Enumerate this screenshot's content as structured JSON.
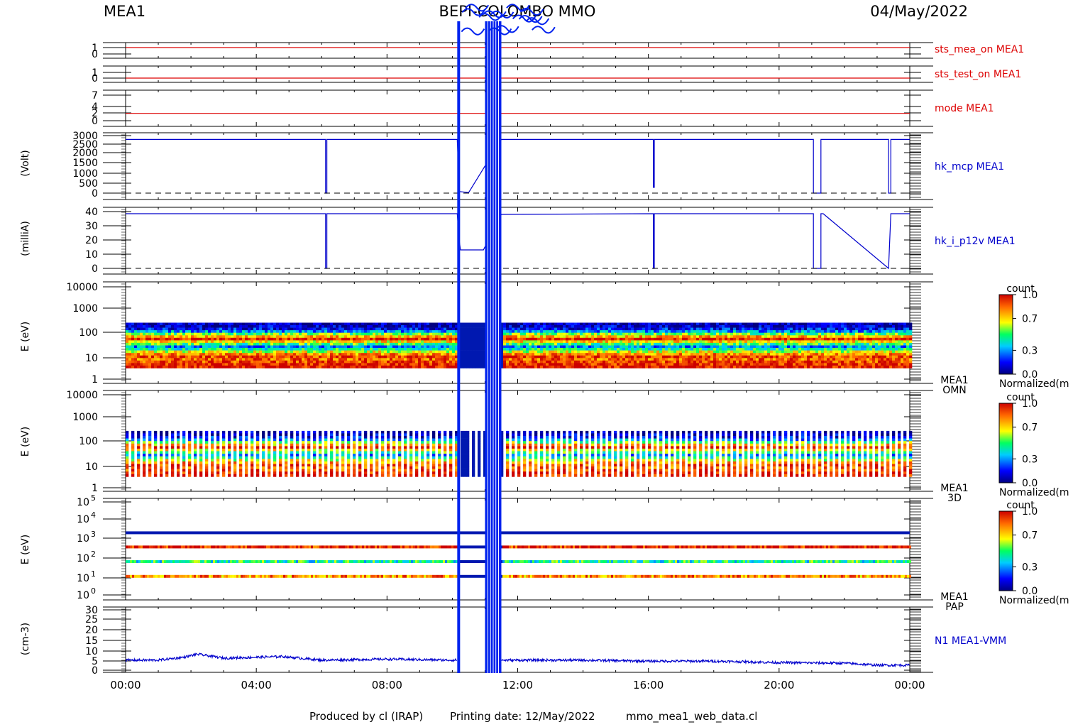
{
  "header": {
    "left": "MEA1",
    "center": "BEPI-COLOMBO MMO",
    "right": "04/May/2022"
  },
  "footer": {
    "producer": "Produced by cl (IRAP)",
    "printing": "Printing date: 12/May/2022",
    "script": "mmo_mea1_web_data.cl"
  },
  "colors": {
    "red_trace": "#dd0000",
    "blue_trace": "#0000cc",
    "gap_blue": "#0022ee"
  },
  "chart_data": {
    "type": "line",
    "x_ticks": [
      "00:00",
      "04:00",
      "08:00",
      "12:00",
      "16:00",
      "20:00",
      "00:00"
    ],
    "x_range_hours": [
      0,
      24
    ],
    "gaps": [
      {
        "start_hour": 10.15,
        "end_hour": 10.22
      },
      {
        "start_hour": 11.0,
        "end_hour": 11.5
      }
    ],
    "panels": [
      {
        "id": "sts_mea_on",
        "label": "sts_mea_on MEA1",
        "label_color": "#dd0000",
        "type": "line",
        "ylabel": "",
        "yticks": [
          "1",
          "0"
        ],
        "ylim": [
          0,
          1
        ],
        "series": [
          {
            "x": [
              0,
              24
            ],
            "y": [
              1,
              1
            ]
          }
        ]
      },
      {
        "id": "sts_test_on",
        "label": "sts_test_on MEA1",
        "label_color": "#dd0000",
        "type": "line",
        "ylabel": "",
        "yticks": [
          "1",
          "0"
        ],
        "ylim": [
          0,
          1
        ],
        "series": [
          {
            "x": [
              0,
              24
            ],
            "y": [
              0,
              0
            ]
          }
        ]
      },
      {
        "id": "mode",
        "label": "mode MEA1",
        "label_color": "#dd0000",
        "type": "line",
        "ylabel": "",
        "yticks": [
          "7",
          "4",
          "2",
          "0"
        ],
        "ylim": [
          0,
          7
        ],
        "series": [
          {
            "x": [
              0,
              24
            ],
            "y": [
              2,
              2
            ]
          }
        ]
      },
      {
        "id": "hk_mcp",
        "label": "hk_mcp MEA1",
        "label_color": "#0000cc",
        "type": "line",
        "ylabel": "(Volt)",
        "yticks": [
          "3000",
          "2500",
          "2000",
          "1500",
          "1000",
          "500",
          "0"
        ],
        "ylim": [
          0,
          3000
        ],
        "series": [
          {
            "x": [
              0,
              6.12,
              6.12,
              6.16,
              6.16,
              10.15,
              10.22,
              10.5,
              11.5,
              16.15,
              16.15,
              16.18,
              16.18,
              21.05,
              21.05,
              21.28,
              21.28,
              21.35,
              21.35,
              23.35,
              23.35,
              23.42,
              23.42,
              24
            ],
            "y": [
              2800,
              2800,
              0,
              0,
              2800,
              2800,
              80,
              30,
              2800,
              2800,
              300,
              300,
              2800,
              2800,
              0,
              0,
              2800,
              2800,
              2800,
              2800,
              0,
              0,
              2800,
              2800
            ]
          }
        ]
      },
      {
        "id": "hk_i_p12v",
        "label": "hk_i_p12v MEA1",
        "label_color": "#0000cc",
        "type": "line",
        "ylabel": "(milliA)",
        "yticks": [
          "40",
          "30",
          "20",
          "10",
          "0"
        ],
        "ylim": [
          0,
          40
        ],
        "series": [
          {
            "x": [
              0,
              6.12,
              6.12,
              6.16,
              6.16,
              10.15,
              10.22,
              10.25,
              10.95,
              11.5,
              16.15,
              16.15,
              16.18,
              16.18,
              21.05,
              21.05,
              21.28,
              21.28,
              21.35,
              21.35,
              23.35,
              23.35,
              23.42,
              23.42,
              24
            ],
            "y": [
              38.5,
              38.5,
              0,
              0,
              38.5,
              38.5,
              18,
              13,
              13,
              38,
              38.5,
              0,
              0,
              38.5,
              38.5,
              0,
              0,
              38.5,
              38.5,
              38.5,
              0,
              0,
              38.5,
              38.5,
              38.5
            ]
          }
        ]
      },
      {
        "id": "omn",
        "label": "MEA1",
        "label2": "OMN",
        "label_color": "#000000",
        "type": "heatmap",
        "ylabel": "E (eV)",
        "yscale": "log",
        "yticks": [
          "10000",
          "1000",
          "100",
          "10",
          "1"
        ],
        "ylim": [
          1,
          10000
        ],
        "e_range": [
          3,
          280
        ],
        "colorbar": {
          "title": "count",
          "ticks": [
            "1.0",
            "0.7",
            "0.3",
            "0.0"
          ],
          "footer": "Normalized(m"
        }
      },
      {
        "id": "3d",
        "label": "MEA1",
        "label2": "3D",
        "label_color": "#000000",
        "type": "heatmap",
        "ylabel": "E (eV)",
        "yscale": "log",
        "yticks": [
          "10000",
          "1000",
          "100",
          "10",
          "1"
        ],
        "ylim": [
          1,
          10000
        ],
        "e_range": [
          3,
          280
        ],
        "colorbar": {
          "title": "count",
          "ticks": [
            "1.0",
            "0.7",
            "0.3",
            "0.0"
          ],
          "footer": "Normalized(m"
        }
      },
      {
        "id": "pap",
        "label": "MEA1",
        "label2": "PAP",
        "label_color": "#000000",
        "type": "heatmap",
        "ylabel": "E (eV)",
        "yscale": "log",
        "yticks_base": "10",
        "yticks_exp": [
          "5",
          "4",
          "3",
          "2",
          "1",
          "0"
        ],
        "ylim": [
          1,
          100000
        ],
        "bands_eV": [
          2200,
          380,
          62,
          10
        ],
        "colorbar": {
          "title": "count",
          "ticks": [
            "1.0",
            "0.7",
            "0.3",
            "0.0"
          ],
          "footer": "Normalized(m"
        }
      },
      {
        "id": "n1",
        "label": "N1 MEA1-VMM",
        "label_color": "#0000cc",
        "type": "line",
        "ylabel": "(cm-3)",
        "yticks": [
          "30",
          "25",
          "20",
          "15",
          "10",
          "5",
          "0"
        ],
        "ylim": [
          0,
          30
        ],
        "series": [
          {
            "x": [
              0,
              1,
              1.8,
              2.2,
              3,
              4.8,
              6,
              8,
              10,
              10.15,
              11.5,
              14,
              16,
              18,
              20,
              22,
              23,
              24
            ],
            "y": [
              5,
              5,
              6.5,
              8,
              6,
              6.8,
              5,
              5.5,
              5,
              5,
              5,
              5,
              4.5,
              4.5,
              3.8,
              3.5,
              2.5,
              2.5
            ]
          }
        ]
      }
    ]
  }
}
